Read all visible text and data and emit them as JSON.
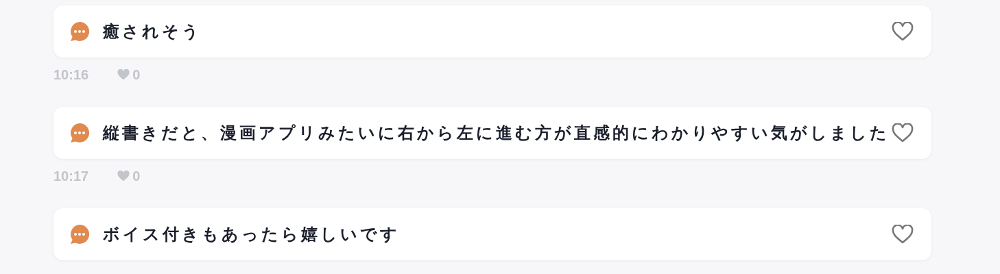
{
  "comments": [
    {
      "text": "癒されそう",
      "time": "10:16",
      "likes": "0",
      "liked": false
    },
    {
      "text": "縦書きだと、漫画アプリみたいに右から左に進む方が直感的にわかりやすい気がしました",
      "time": "10:17",
      "likes": "0",
      "liked": false
    },
    {
      "text": "ボイス付きもあったら嬉しいです",
      "liked": false
    }
  ]
}
